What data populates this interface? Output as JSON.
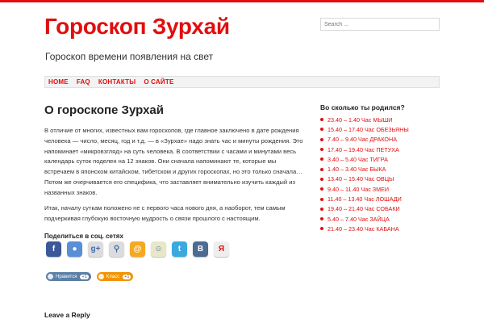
{
  "site": {
    "title": "Гороскоп Зурхай",
    "description": "Гороскоп времени появления на свет",
    "accent": "#e10e0e"
  },
  "search": {
    "placeholder": "Search ..."
  },
  "nav": {
    "items": [
      {
        "label": "HOME"
      },
      {
        "label": "FAQ"
      },
      {
        "label": "КОНТАКТЫ"
      },
      {
        "label": "О САЙТЕ"
      }
    ]
  },
  "post": {
    "title": "О гороскопе Зурхай",
    "paragraph_1": "В отличие от многих, известных вам гороскопов, где главное заключено в дате рождения человека — число, месяц, год и т.д. — в «Зурхае» надо знать час и минуты рождения. Это напоминает «микровзгляд» на суть человека. В соответствии с часами и минутами весь календарь суток поделен на 12 знаков. Они сначала напоминают те, которые мы встречаем в японском китайском, тибетском и других гороскопах, но это только сначала… Потом же очерчивается его специфика, что заставляет внимательно изучить каждый из названных знаков.",
    "paragraph_2": "Итак, началу суткам положено не с первого часа нового дня, а наоборот, тем самым подчеркивая глубокую восточную мудрость о связи прошлого с настоящим."
  },
  "share": {
    "heading": "Поделиться в соц. сетях",
    "buttons": [
      {
        "icon": "facebook-icon",
        "glyph": "f",
        "color": "#3b5998"
      },
      {
        "icon": "chat-icon",
        "glyph": "●",
        "color": "#5a8ed6"
      },
      {
        "icon": "google-plus-icon",
        "glyph": "g+",
        "color": "#dcdcdc"
      },
      {
        "icon": "paperclip-icon",
        "glyph": "⚲",
        "color": "#dcdcdc"
      },
      {
        "icon": "mail-at-icon",
        "glyph": "@",
        "color": "#f6a821"
      },
      {
        "icon": "odnoklassniki-icon",
        "glyph": "☺",
        "color": "#e8e8c8"
      },
      {
        "icon": "twitter-icon",
        "glyph": "t",
        "color": "#3aa9e0"
      },
      {
        "icon": "vkontakte-icon",
        "glyph": "B",
        "color": "#4c6c91"
      },
      {
        "icon": "yandex-icon",
        "glyph": "Я",
        "color": "#eeeeee"
      }
    ]
  },
  "likes": {
    "vk": {
      "label": "Нравится",
      "count": "+1",
      "color": "#5b7fa6"
    },
    "ok": {
      "label": "Класс",
      "count": "+1",
      "color": "#f29400"
    }
  },
  "comments": {
    "heading": "Leave a Reply"
  },
  "sidebar": {
    "title": "Во сколько ты родился?",
    "items": [
      {
        "label": "23.40 – 1.40 Час МЫШИ"
      },
      {
        "label": "15.40 – 17.40 Час ОБЕЗЬЯНЫ"
      },
      {
        "label": "7.40 – 9.40 Час ДРАКОНА"
      },
      {
        "label": "17.40 – 19.40 Час ПЕТУХА"
      },
      {
        "label": "3.40 – 5.40 Час ТИГРА"
      },
      {
        "label": "1.40 – 3.40 Час БЫКА"
      },
      {
        "label": "13.40 – 15.40 Час ОВЦЫ"
      },
      {
        "label": "9.40 – 11.40 Час ЗМЕИ"
      },
      {
        "label": "11.40 – 13.40 Час ЛОШАДИ"
      },
      {
        "label": "19.40 – 21.40 Час СОБАКИ"
      },
      {
        "label": "5.40 – 7.40 Час ЗАЙЦА"
      },
      {
        "label": "21.40 – 23.40 Час КАБАНА"
      }
    ]
  }
}
